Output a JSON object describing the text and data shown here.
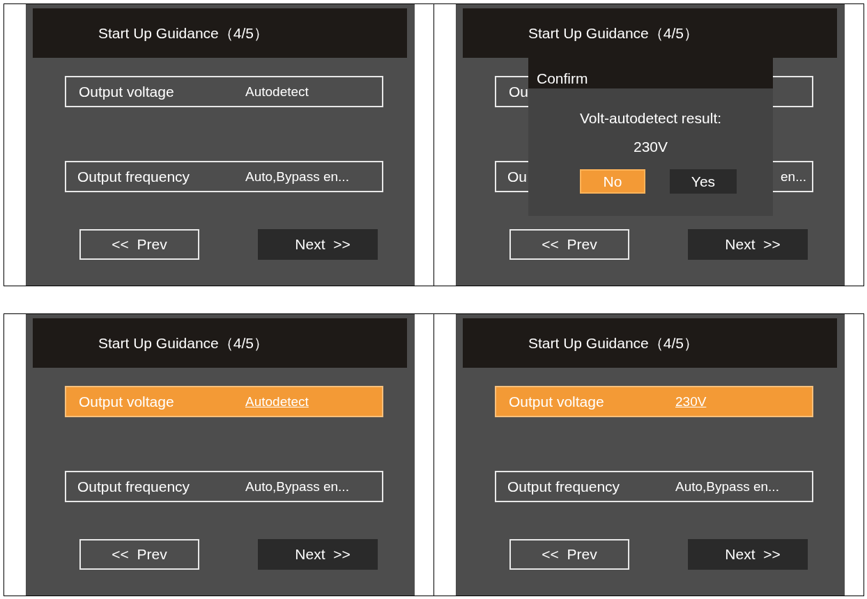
{
  "screens": [
    {
      "title": "Start Up Guidance（4/5）",
      "settings": [
        {
          "label": "Output voltage",
          "value": "Autodetect",
          "selected": false
        },
        {
          "label": "Output frequency",
          "value": "Auto,Bypass en...",
          "selected": false
        }
      ],
      "buttons": [
        {
          "label": "<< Prev",
          "kind": "outline"
        },
        {
          "label": "Next >>",
          "kind": "filled"
        }
      ]
    },
    {
      "title": "Start Up Guidance（4/5）",
      "settings": [
        {
          "label": "Ou",
          "selected": false
        },
        {
          "label": "Ou",
          "value": "en...",
          "selected": false
        }
      ],
      "buttons": [
        {
          "label": "<< Prev",
          "kind": "outline"
        },
        {
          "label": "Next >>",
          "kind": "filled"
        }
      ],
      "dialog": {
        "title": "Confirm",
        "message": "Volt-autodetect result:",
        "result": "230V",
        "buttons": [
          {
            "label": "No",
            "selected": true
          },
          {
            "label": "Yes",
            "selected": false
          }
        ]
      }
    },
    {
      "title": "Start Up Guidance（4/5）",
      "settings": [
        {
          "label": "Output voltage",
          "value": "Autodetect",
          "selected": true
        },
        {
          "label": "Output frequency",
          "value": "Auto,Bypass en...",
          "selected": false
        }
      ],
      "buttons": [
        {
          "label": "<< Prev",
          "kind": "outline"
        },
        {
          "label": "Next >>",
          "kind": "filled"
        }
      ]
    },
    {
      "title": "Start Up Guidance（4/5）",
      "settings": [
        {
          "label": "Output voltage",
          "value": "230V",
          "selected": true
        },
        {
          "label": "Output frequency",
          "value": "Auto,Bypass en...",
          "selected": false
        }
      ],
      "buttons": [
        {
          "label": "<< Prev",
          "kind": "outline"
        },
        {
          "label": "Next >>",
          "kind": "filled"
        }
      ]
    }
  ]
}
